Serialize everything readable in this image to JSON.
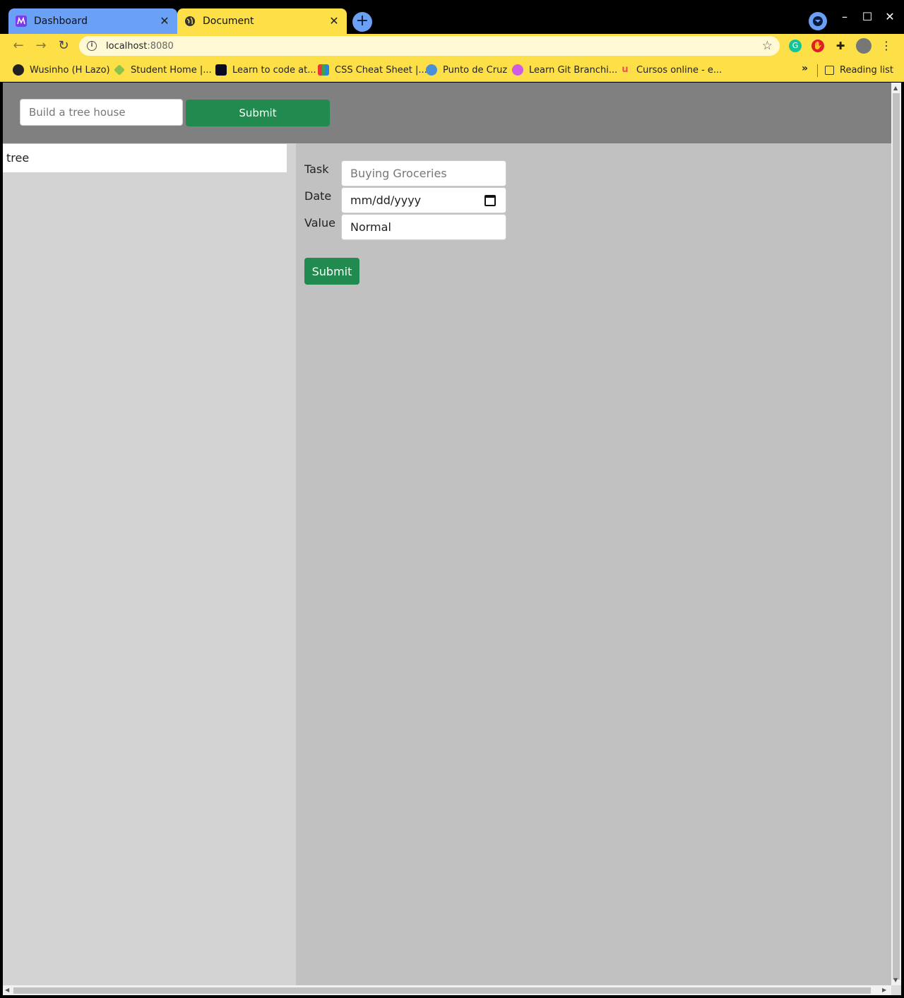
{
  "browser": {
    "tabs": [
      {
        "title": "Dashboard",
        "close": "✕"
      },
      {
        "title": "Document",
        "close": "✕"
      }
    ],
    "new_tab": "+",
    "window_controls": {
      "minimize": "–",
      "maximize": "☐",
      "close": "✕"
    },
    "nav": {
      "back": "←",
      "forward": "→",
      "reload": "↻"
    },
    "address": {
      "host": "localhost",
      "port": ":8080"
    },
    "bookmarks": [
      "Wusinho (H Lazo)",
      "Student Home |...",
      "Learn to code at...",
      "CSS Cheat Sheet |...",
      "Punto de Cruz",
      "Learn Git Branchi...",
      "Cursos online - e..."
    ],
    "bookmarks_more": "»",
    "reading_list": "Reading list"
  },
  "page": {
    "top_input_placeholder": "Build a tree house",
    "top_submit_label": "Submit",
    "list_items": [
      "tree"
    ],
    "form": {
      "task_label": "Task",
      "task_placeholder": "Buying Groceries",
      "date_label": "Date",
      "date_value": "mm/dd/yyyy",
      "value_label": "Value",
      "value_value": "Normal",
      "submit_label": "Submit"
    }
  },
  "colors": {
    "tab_active": "#fde047",
    "tab_inactive": "#6aa0f5",
    "submit_green": "#218a4f",
    "header_gray": "#808080"
  }
}
